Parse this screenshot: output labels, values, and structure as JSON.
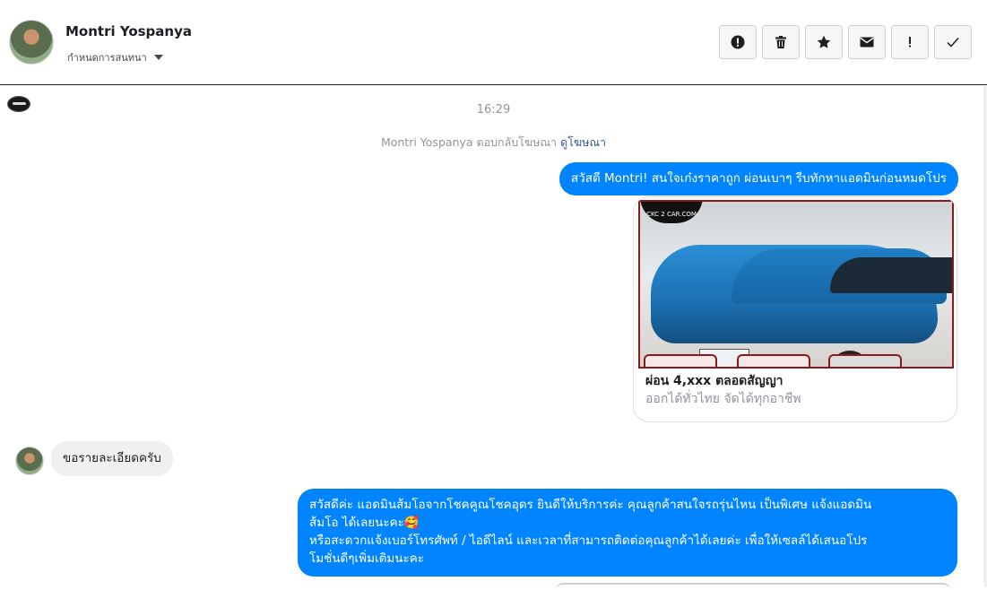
{
  "header": {
    "name": "Montri Yospanya",
    "subline": "กำหนดการสนทนา"
  },
  "conversation": {
    "time": "16:29",
    "reply_note": "Montri Yospanya ตอบกลับโฆษณา",
    "reply_link": "ดูโฆษณา",
    "msg1": "สวัสดี Montri! สนใจเก๋งราคาถูก ผ่อนเบาๆ รีบทักหาแอดมินก่อนหมดโปร",
    "card_brand": "CKC 2 CAR.COM",
    "card_title": "ผ่อน 4,xxx ตลอดสัญญา",
    "card_sub": "ออกได้ทั่วไทย จัดได้ทุกอาชีพ",
    "msg2": "ขอรายละเอียดครับ",
    "msg3_lines": [
      "สวัสดีค่ะ แอดมินส้มโอจากโชคคูณโชคอุดร ยินดีให้บริการค่ะ   คุณลูกค้าสนใจรถรุ่นไหน เป็นพิเศษ แจ้งแอดมิน",
      "ส้มโอ ได้เลยนะคะ🥰",
      "หรือสะดวกแจ้งเบอร์โทรศัพท์ / ไอดีไลน์ และเวลาที่สามารถติดต่อคุณลูกค้าได้เลยค่ะ เพื่อให้เซลล์ได้เสนอโปร",
      "โมชั่นดีๆเพิ่มเติมนะคะ"
    ]
  },
  "colors": {
    "outgoing": "#0084ff",
    "incoming": "#f1f0f0"
  }
}
